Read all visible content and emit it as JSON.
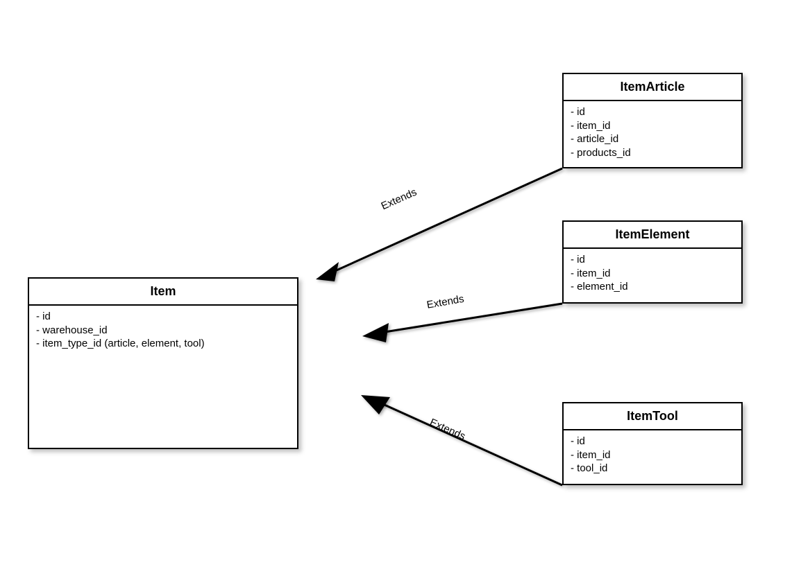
{
  "classes": {
    "item": {
      "title": "Item",
      "attrs": [
        "- id",
        "- warehouse_id",
        "- item_type_id (article, element, tool)"
      ]
    },
    "itemArticle": {
      "title": "ItemArticle",
      "attrs": [
        "- id",
        "- item_id",
        "- article_id",
        "- products_id"
      ]
    },
    "itemElement": {
      "title": "ItemElement",
      "attrs": [
        "- id",
        "- item_id",
        "- element_id"
      ]
    },
    "itemTool": {
      "title": "ItemTool",
      "attrs": [
        "- id",
        "- item_id",
        "- tool_id"
      ]
    }
  },
  "edges": {
    "e1": "Extends",
    "e2": "Extends",
    "e3": "Extends"
  }
}
